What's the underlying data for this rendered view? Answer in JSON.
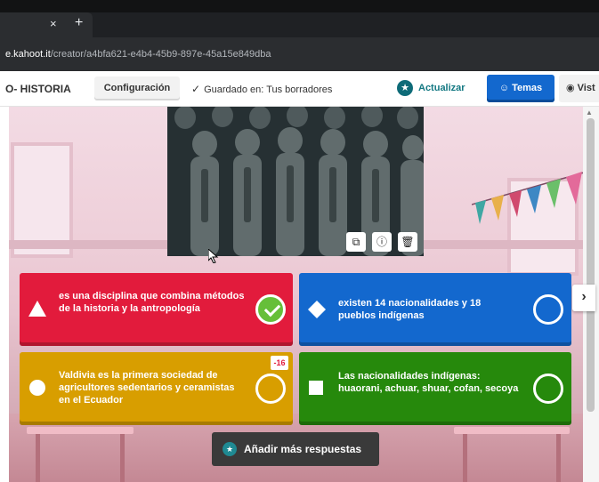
{
  "browser": {
    "tab_close": "×",
    "tab_new": "+",
    "url_host": "e.kahoot.it",
    "url_path": "/creator/a4bfa621-e4b4-45b9-897e-45a15e849dba"
  },
  "header": {
    "title": "O- HISTORIA",
    "settings_label": "Configuración",
    "saved_check": "✓",
    "saved_text": "Guardado en: Tus borradores",
    "update_label": "Actualizar",
    "themes_label": "Temas",
    "preview_label": "Vist"
  },
  "media": {
    "buttons": [
      "crop-icon",
      "info-icon",
      "trash-icon"
    ]
  },
  "answers": [
    {
      "color": "#e21b3c",
      "shape": "triangle",
      "text": "es una disciplina que combina métodos de la historia y la antropología",
      "correct": true
    },
    {
      "color": "#1368ce",
      "shape": "diamond",
      "text": "existen 14 nacionalidades y 18 pueblos indígenas",
      "correct": false
    },
    {
      "color": "#d89e00",
      "shape": "circle",
      "text_bold": "Valdivia",
      "text": " es la primera sociedad de agricultores sedentarios y ceramistas en el Ecuador",
      "correct": false,
      "badge": "-16"
    },
    {
      "color": "#26890c",
      "shape": "square",
      "text": "Las nacionalidades indígenas: huaorani, achuar, shuar, cofan, secoya",
      "correct": false
    }
  ],
  "add_more_label": "Añadir más respuestas",
  "next_arrow": "›"
}
